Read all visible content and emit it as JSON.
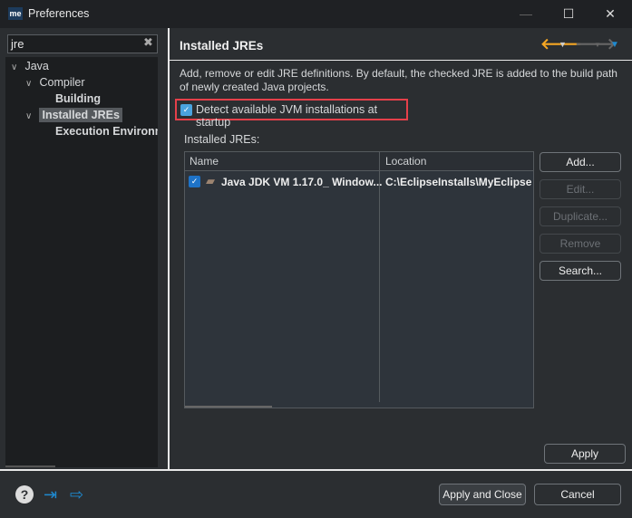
{
  "window": {
    "title": "Preferences",
    "logo": "me"
  },
  "search": {
    "value": "jre"
  },
  "tree": [
    {
      "label": "Java",
      "expanded": true
    },
    {
      "label": "Compiler",
      "expanded": true
    },
    {
      "label": "Building"
    },
    {
      "label": "Installed JREs",
      "expanded": true,
      "selected": true
    },
    {
      "label": "Execution Environments"
    }
  ],
  "page": {
    "title": "Installed JREs",
    "description": "Add, remove or edit JRE definitions. By default, the checked JRE is added to the build path of newly created Java projects.",
    "detect_label": "Detect available JVM installations at startup",
    "detect_checked": true,
    "table_label": "Installed JREs:",
    "columns": [
      "Name",
      "Location"
    ],
    "rows": [
      {
        "checked": true,
        "name": "Java JDK VM 1.17.0_ Window...",
        "location": "C:\\EclipseInstalls\\MyEclipse CI"
      }
    ],
    "buttons": {
      "add": "Add...",
      "edit": "Edit...",
      "duplicate": "Duplicate...",
      "remove": "Remove",
      "search": "Search..."
    },
    "apply": "Apply"
  },
  "footer": {
    "apply_close": "Apply and Close",
    "cancel": "Cancel"
  },
  "colors": {
    "accent": "#1e8ad0",
    "highlight_border": "#e5404a",
    "back_arrow": "#f5a623"
  }
}
